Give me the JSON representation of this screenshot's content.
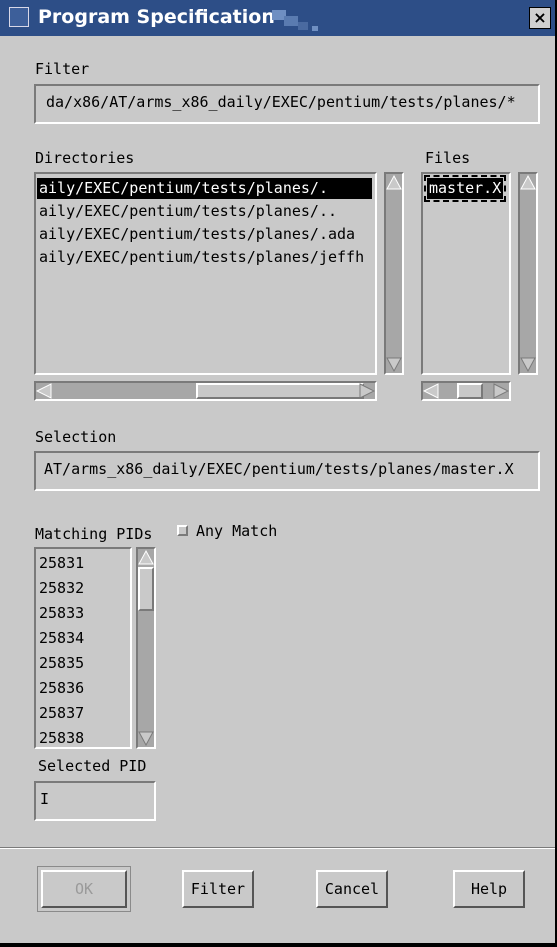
{
  "window": {
    "title": "Program Specification",
    "close_glyph": "×"
  },
  "filter": {
    "label": "Filter",
    "value": "da/x86/AT/arms_x86_daily/EXEC/pentium/tests/planes/*"
  },
  "directories": {
    "label": "Directories",
    "items": [
      "aily/EXEC/pentium/tests/planes/.",
      "aily/EXEC/pentium/tests/planes/..",
      "aily/EXEC/pentium/tests/planes/.ada",
      "aily/EXEC/pentium/tests/planes/jeffh"
    ],
    "selected_index": 0
  },
  "files": {
    "label": "Files",
    "items": [
      "master.X"
    ]
  },
  "selection": {
    "label": "Selection",
    "value": "AT/arms_x86_daily/EXEC/pentium/tests/planes/master.X"
  },
  "pids": {
    "label": "Matching PIDs",
    "items": [
      "25831",
      "25832",
      "25833",
      "25834",
      "25835",
      "25836",
      "25837",
      "25838"
    ]
  },
  "any_match": {
    "label": "Any Match",
    "checked": false
  },
  "selected_pid": {
    "label": "Selected PID",
    "value": ""
  },
  "buttons": {
    "ok": "OK",
    "filter": "Filter",
    "cancel": "Cancel",
    "help": "Help"
  }
}
